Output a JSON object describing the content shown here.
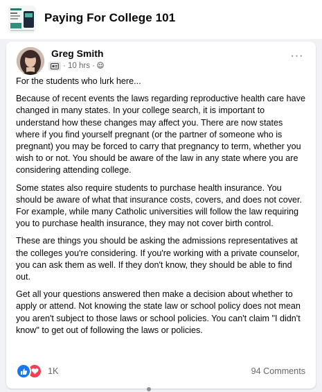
{
  "group": {
    "name": "Paying For College 101"
  },
  "post": {
    "author": "Greg Smith",
    "timestamp": "· 10 hrs ·",
    "paragraphs": [
      "For the students who lurk here...",
      "Because of recent events the laws regarding reproductive health care have changed in many states. In your college search, it is important to understand how these changes may affect you. There are now states where if you find yourself pregnant (or the partner of someone who is pregnant) you may be forced to carry that pregnancy to term, whether you wish to or not. You should be aware of the law in any state where you are considering attending college.",
      "Some states also require students to purchase health insurance. You should be aware of what that insurance costs, covers, and does not cover. For example, while many Catholic universities will follow the law requiring you to purchase health insurance, they may not cover birth control.",
      "These are things you should be asking the admissions representatives at the colleges you're considering. If you're working with a private counselor, you can ask them as well.  If they don't know, they should be able to find out.",
      "Get all your questions answered then make a decision about whether to apply or attend.  Not knowing the state law or school policy does not mean you aren't subject to those laws or school policies. You can't claim \"I didn't know\" to get out of following the laws or policies."
    ],
    "reactions": {
      "count": "1K",
      "types": [
        "like-icon",
        "love-icon"
      ]
    },
    "comments_label": "94 Comments",
    "more_label": "···"
  },
  "colors": {
    "like": "#1877f2",
    "love": "#f33e58",
    "secondary_text": "#65676b",
    "background": "#f0f2f5"
  }
}
